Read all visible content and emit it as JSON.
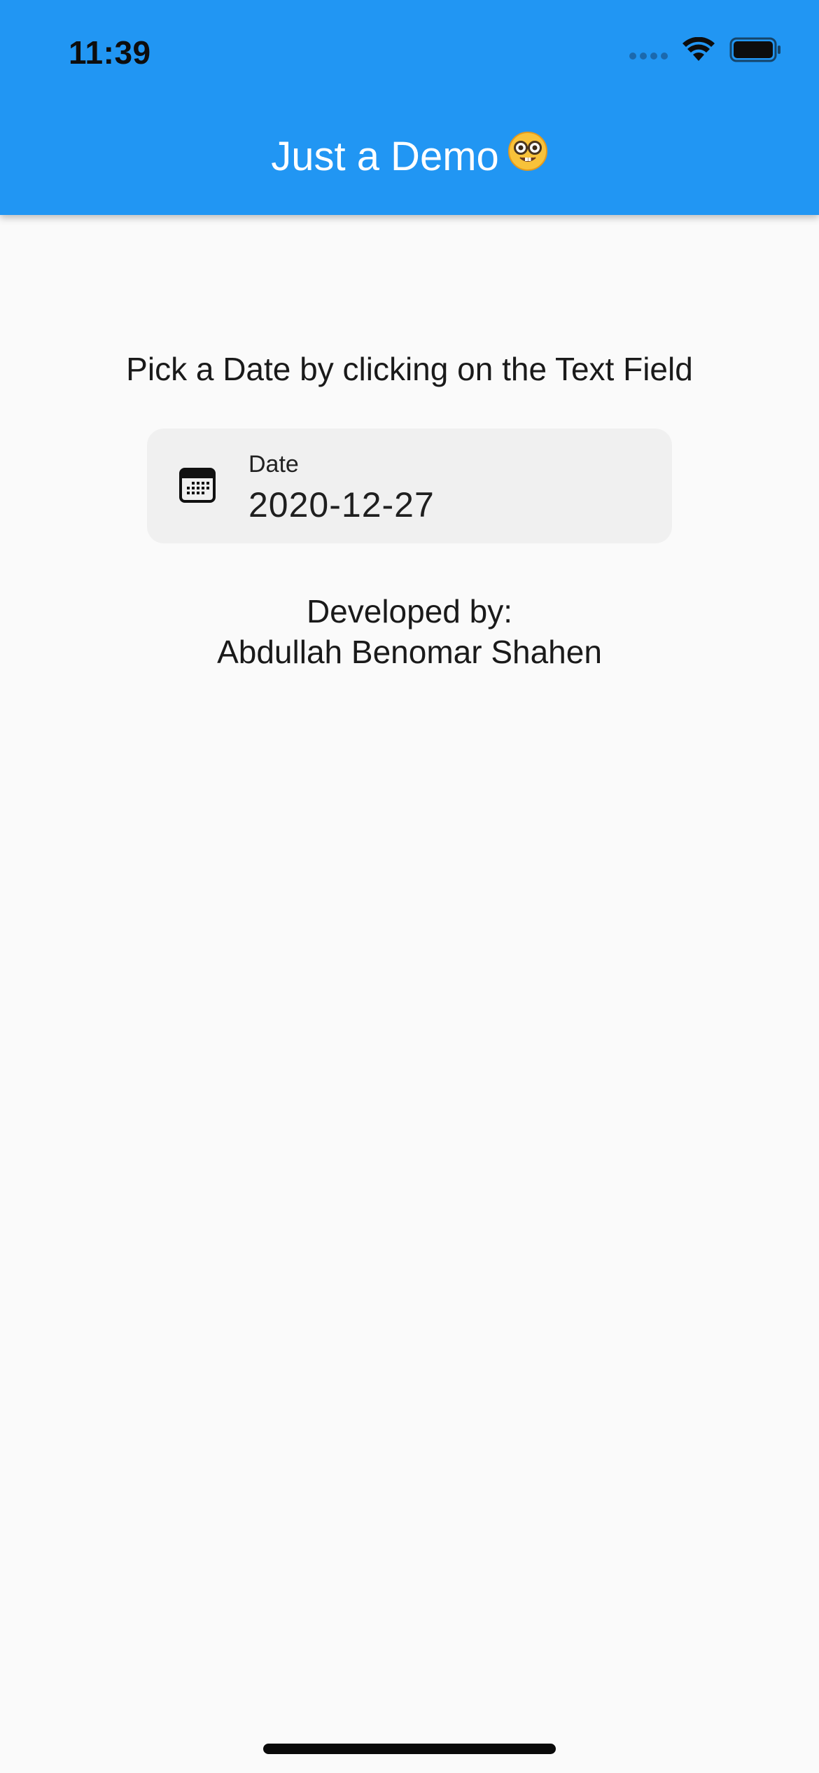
{
  "status_bar": {
    "time": "11:39"
  },
  "app_bar": {
    "title": "Just a Demo",
    "emoji": "🤓",
    "color": "#2196f3"
  },
  "main": {
    "instruction": "Pick a Date by clicking on the Text Field",
    "date_field": {
      "label": "Date",
      "value": "2020-12-27",
      "icon": "calendar-icon"
    },
    "credits": {
      "line1": "Developed by:",
      "line2": "Abdullah Benomar Shahen"
    }
  }
}
